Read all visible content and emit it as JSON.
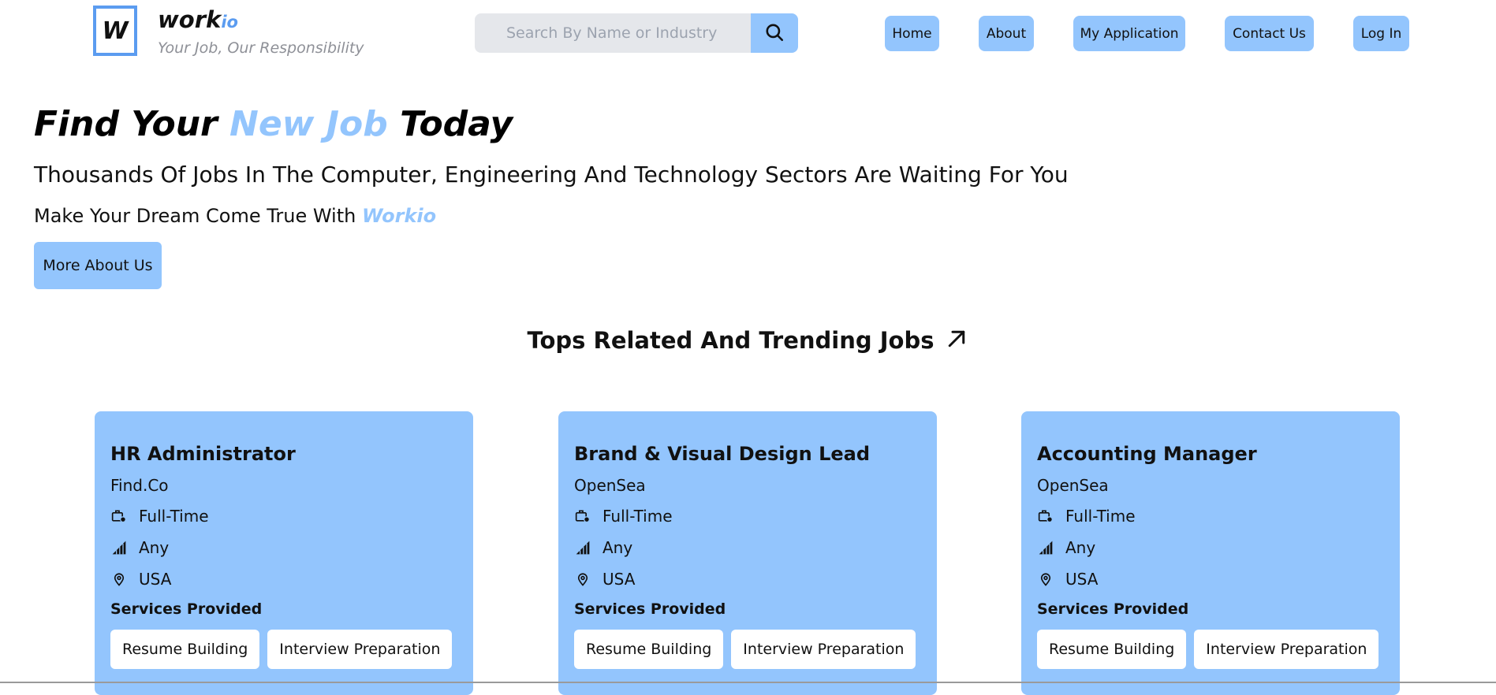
{
  "header": {
    "logo_letter": "W",
    "brand_main": "work",
    "brand_suffix": "io",
    "tagline": "Your Job, Our Responsibility",
    "search_placeholder": "Search By Name or Industry",
    "search_icon": "search-icon",
    "nav": [
      {
        "label": "Home"
      },
      {
        "label": "About"
      },
      {
        "label": "My Application"
      },
      {
        "label": "Contact Us"
      },
      {
        "label": "Log In"
      }
    ]
  },
  "hero": {
    "title_part1": "Find Your ",
    "title_accent": "New Job",
    "title_part2": " Today",
    "subtitle": "Thousands Of Jobs In The Computer, Engineering And Technology Sectors Are Waiting For You",
    "dream_text": "Make Your Dream Come True With ",
    "dream_brand": "Workio",
    "more_button": "More About Us"
  },
  "section": {
    "title": "Tops Related And Trending Jobs",
    "icon": "arrow-up-right-icon"
  },
  "jobs": [
    {
      "title": "HR Administrator",
      "company": "Find.Co",
      "type": "Full-Time",
      "level": "Any",
      "location": "USA",
      "services_label": "Services Provided",
      "services": [
        "Resume Building",
        "Interview Preparation"
      ]
    },
    {
      "title": "Brand & Visual Design Lead",
      "company": "OpenSea",
      "type": "Full-Time",
      "level": "Any",
      "location": "USA",
      "services_label": "Services Provided",
      "services": [
        "Resume Building",
        "Interview Preparation"
      ]
    },
    {
      "title": "Accounting Manager",
      "company": "OpenSea",
      "type": "Full-Time",
      "level": "Any",
      "location": "USA",
      "services_label": "Services Provided",
      "services": [
        "Resume Building",
        "Interview Preparation"
      ]
    }
  ],
  "colors": {
    "accent": "#93c5fd",
    "logo_border": "#5b9cf0",
    "search_bg": "#e5e7eb"
  }
}
